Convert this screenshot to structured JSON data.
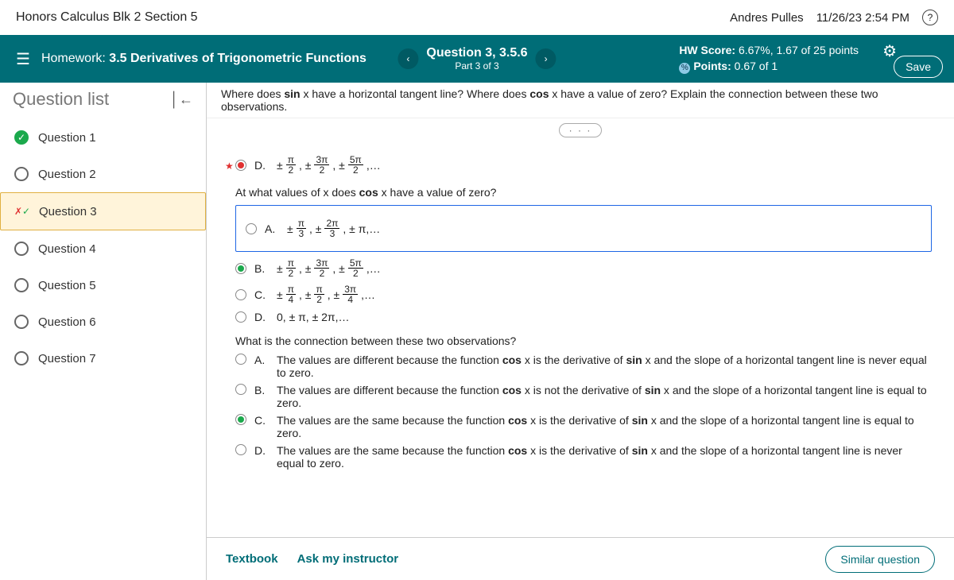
{
  "topbar": {
    "course": "Honors Calculus Blk 2 Section 5",
    "user": "Andres Pulles",
    "datetime": "11/26/23 2:54 PM"
  },
  "header": {
    "hw_label": "Homework:",
    "hw_title": "3.5 Derivatives of Trigonometric Functions",
    "q_number": "Question 3, 3.5.6",
    "q_part": "Part 3 of 3",
    "hw_score_label": "HW Score:",
    "hw_score_value": "6.67%, 1.67 of 25 points",
    "points_label": "Points:",
    "points_value": "0.67 of 1",
    "save": "Save"
  },
  "sidebar": {
    "title": "Question list",
    "items": [
      {
        "label": "Question 1"
      },
      {
        "label": "Question 2"
      },
      {
        "label": "Question 3"
      },
      {
        "label": "Question 4"
      },
      {
        "label": "Question 5"
      },
      {
        "label": "Question 6"
      },
      {
        "label": "Question 7"
      }
    ]
  },
  "prompt": {
    "text_before_sin": "Where does ",
    "sin": "sin",
    "mid1": " x have a horizontal tangent line? Where does ",
    "cos": "cos",
    "mid2": " x have a value of zero? Explain the connection between these two observations."
  },
  "part1": {
    "opt_d_letter": "D.",
    "seq1": "±",
    "n1t": "π",
    "n1b": "2",
    "seq2": ", ±",
    "n2t": "3π",
    "n2b": "2",
    "seq3": ", ±",
    "n3t": "5π",
    "n3b": "2",
    "seq4": ",…"
  },
  "part2": {
    "question": "At what values of x does cos x have a value of zero?",
    "A": {
      "letter": "A.",
      "s1": "±",
      "t1": "π",
      "b1": "3",
      "s2": ", ±",
      "t2": "2π",
      "b2": "3",
      "s3": ", ± π,…"
    },
    "B": {
      "letter": "B.",
      "s1": "±",
      "t1": "π",
      "b1": "2",
      "s2": ", ±",
      "t2": "3π",
      "b2": "2",
      "s3": ", ±",
      "t3": "5π",
      "b3": "2",
      "s4": ",…"
    },
    "C": {
      "letter": "C.",
      "s1": "±",
      "t1": "π",
      "b1": "4",
      "s2": ", ±",
      "t2": "π",
      "b2": "2",
      "s3": ", ±",
      "t3": "3π",
      "b3": "4",
      "s4": ",…"
    },
    "D": {
      "letter": "D.",
      "text": "0, ± π, ± 2π,…"
    }
  },
  "part3": {
    "question": "What is the connection between these two observations?",
    "A": {
      "letter": "A.",
      "text": "The values are different because the function cos x is the derivative of sin x and the slope of a horizontal tangent line is never equal to zero."
    },
    "B": {
      "letter": "B.",
      "text": "The values are different because the function cos x is not the derivative of sin x and the slope of a horizontal tangent line is equal to zero."
    },
    "C": {
      "letter": "C.",
      "text": "The values are the same because the function cos x is the derivative of sin x and the slope of a horizontal tangent line is equal to zero."
    },
    "D": {
      "letter": "D.",
      "text": "The values are the same because the function cos x is the derivative of sin x and the slope of a horizontal tangent line is never equal to zero."
    }
  },
  "footer": {
    "textbook": "Textbook",
    "ask": "Ask my instructor",
    "similar": "Similar question"
  }
}
